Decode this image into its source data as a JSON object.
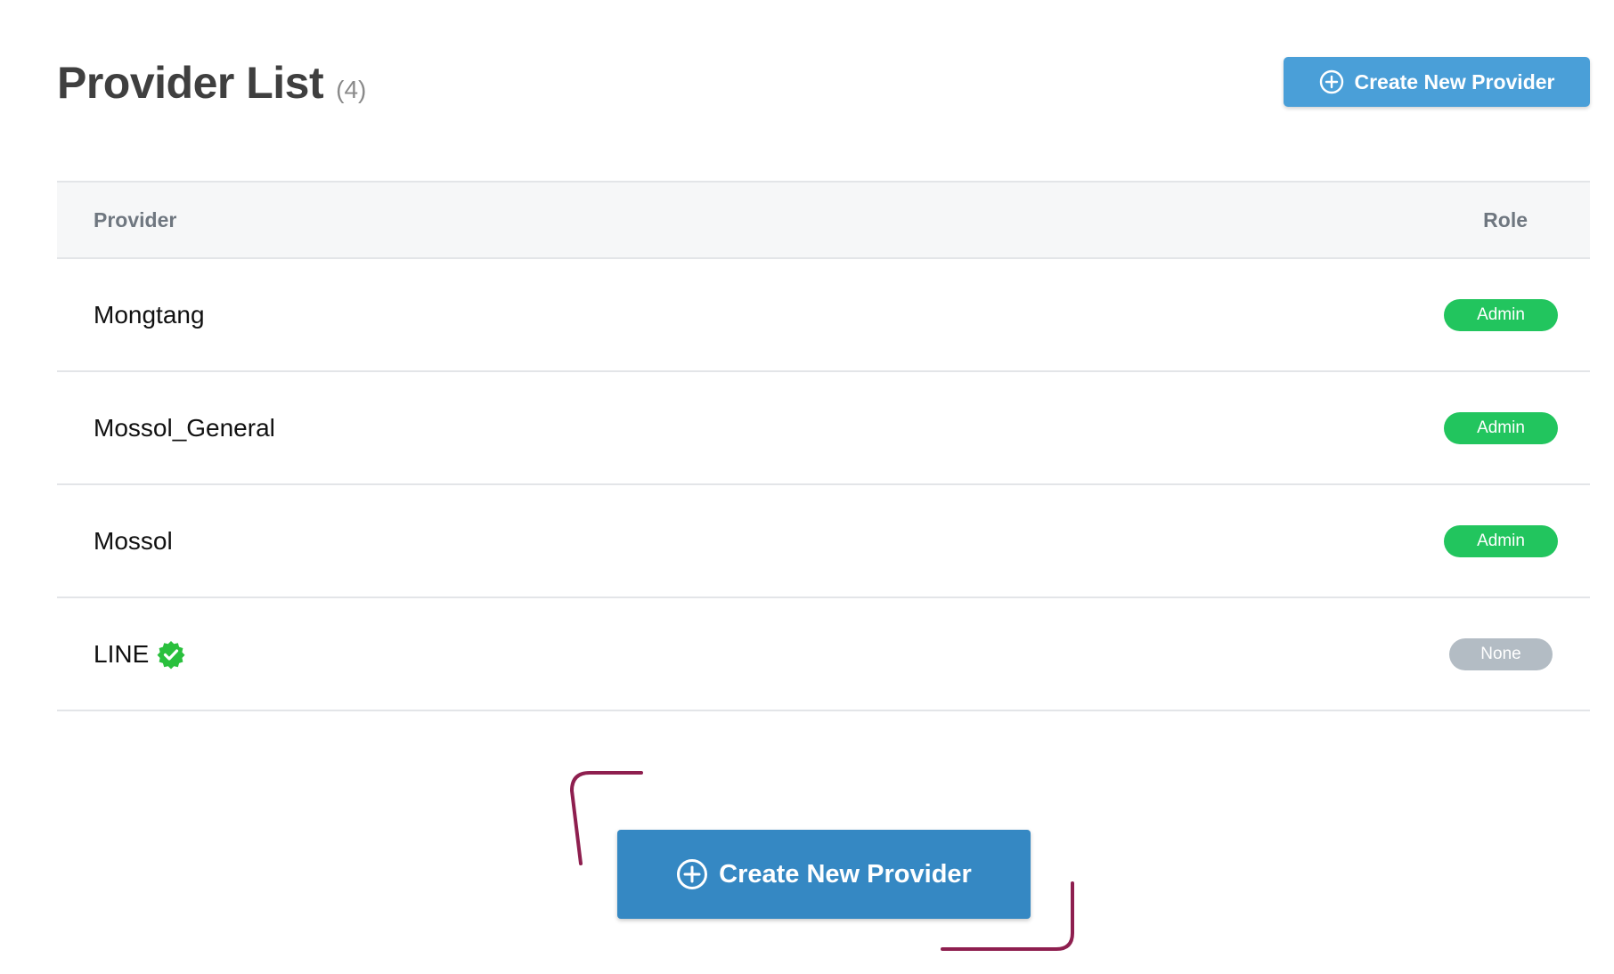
{
  "header": {
    "title": "Provider List",
    "count": "(4)"
  },
  "top_button": {
    "label": "Create New Provider",
    "icon": "plus-circle-icon"
  },
  "table": {
    "columns": [
      "Provider",
      "Role"
    ],
    "rows": [
      {
        "name": "Mongtang",
        "role": "Admin",
        "verified": false
      },
      {
        "name": "Mossol_General",
        "role": "Admin",
        "verified": false
      },
      {
        "name": "Mossol",
        "role": "Admin",
        "verified": false
      },
      {
        "name": "LINE",
        "role": "None",
        "verified": true
      }
    ]
  },
  "bottom_button": {
    "label": "Create New Provider",
    "icon": "plus-circle-icon"
  },
  "colors": {
    "primary_button": "#4a9fd8",
    "highlight_button": "#3588c3",
    "admin_badge": "#22c55e",
    "none_badge": "#b3bcc4",
    "verified": "#2ac03d",
    "annotation": "#8e1f4f"
  }
}
